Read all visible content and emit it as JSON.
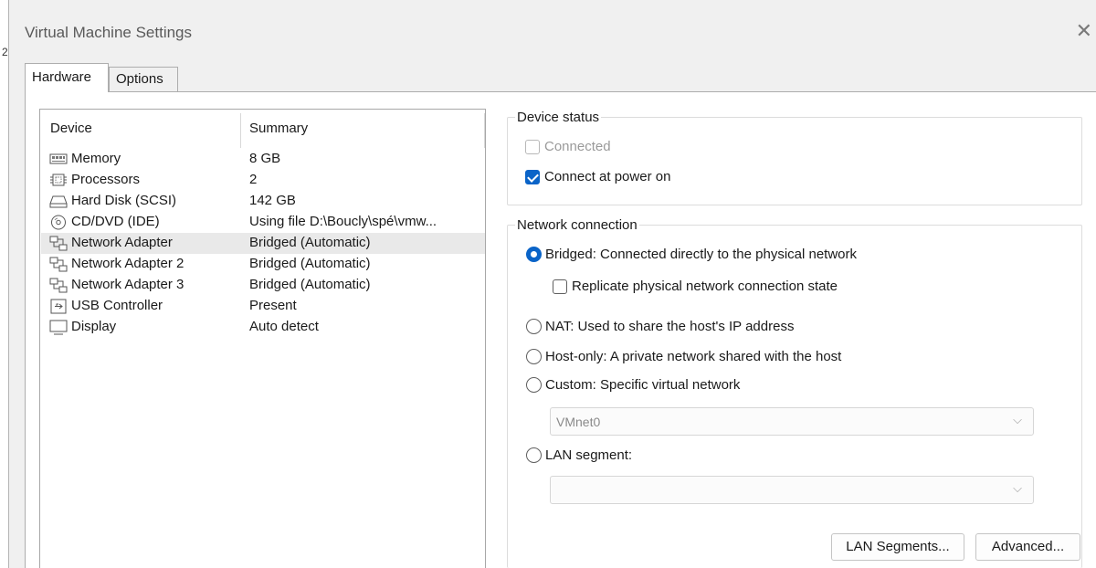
{
  "window": {
    "title": "Virtual Machine Settings",
    "close_glyph": "✕",
    "left_strip_char": "2"
  },
  "tabs": [
    {
      "label": "Hardware",
      "active": true
    },
    {
      "label": "Options",
      "active": false
    }
  ],
  "device_list": {
    "columns": [
      "Device",
      "Summary"
    ],
    "rows": [
      {
        "name": "Memory",
        "summary": "8 GB",
        "icon": "memory-icon"
      },
      {
        "name": "Processors",
        "summary": "2",
        "icon": "processor-icon"
      },
      {
        "name": "Hard Disk (SCSI)",
        "summary": "142 GB",
        "icon": "hard-disk-icon"
      },
      {
        "name": "CD/DVD (IDE)",
        "summary": "Using file D:\\Boucly\\spé\\vmw...",
        "icon": "cd-dvd-icon"
      },
      {
        "name": "Network Adapter",
        "summary": "Bridged (Automatic)",
        "icon": "network-adapter-icon",
        "selected": true
      },
      {
        "name": "Network Adapter 2",
        "summary": "Bridged (Automatic)",
        "icon": "network-adapter-icon"
      },
      {
        "name": "Network Adapter 3",
        "summary": "Bridged (Automatic)",
        "icon": "network-adapter-icon"
      },
      {
        "name": "USB Controller",
        "summary": "Present",
        "icon": "usb-icon"
      },
      {
        "name": "Display",
        "summary": "Auto detect",
        "icon": "display-icon"
      }
    ]
  },
  "device_status": {
    "legend": "Device status",
    "connected": {
      "label": "Connected",
      "checked": false,
      "enabled": false
    },
    "connect_at_power_on": {
      "label": "Connect at power on",
      "checked": true
    }
  },
  "network_connection": {
    "legend": "Network connection",
    "bridged": {
      "label": "Bridged: Connected directly to the physical network",
      "selected": true
    },
    "replicate": {
      "label": "Replicate physical network connection state",
      "checked": false
    },
    "nat": {
      "label": "NAT: Used to share the host's IP address",
      "selected": false
    },
    "host_only": {
      "label": "Host-only: A private network shared with the host",
      "selected": false
    },
    "custom": {
      "label": "Custom: Specific virtual network",
      "selected": false
    },
    "vmnet_select": {
      "value": "VMnet0"
    },
    "lan_segment": {
      "label": "LAN segment:",
      "selected": false
    },
    "lan_segment_select": {
      "value": ""
    }
  },
  "buttons": {
    "lan_segments": "LAN Segments...",
    "advanced": "Advanced..."
  },
  "colors": {
    "accent": "#0a64c8",
    "selected_row": "#e9e9e9"
  }
}
